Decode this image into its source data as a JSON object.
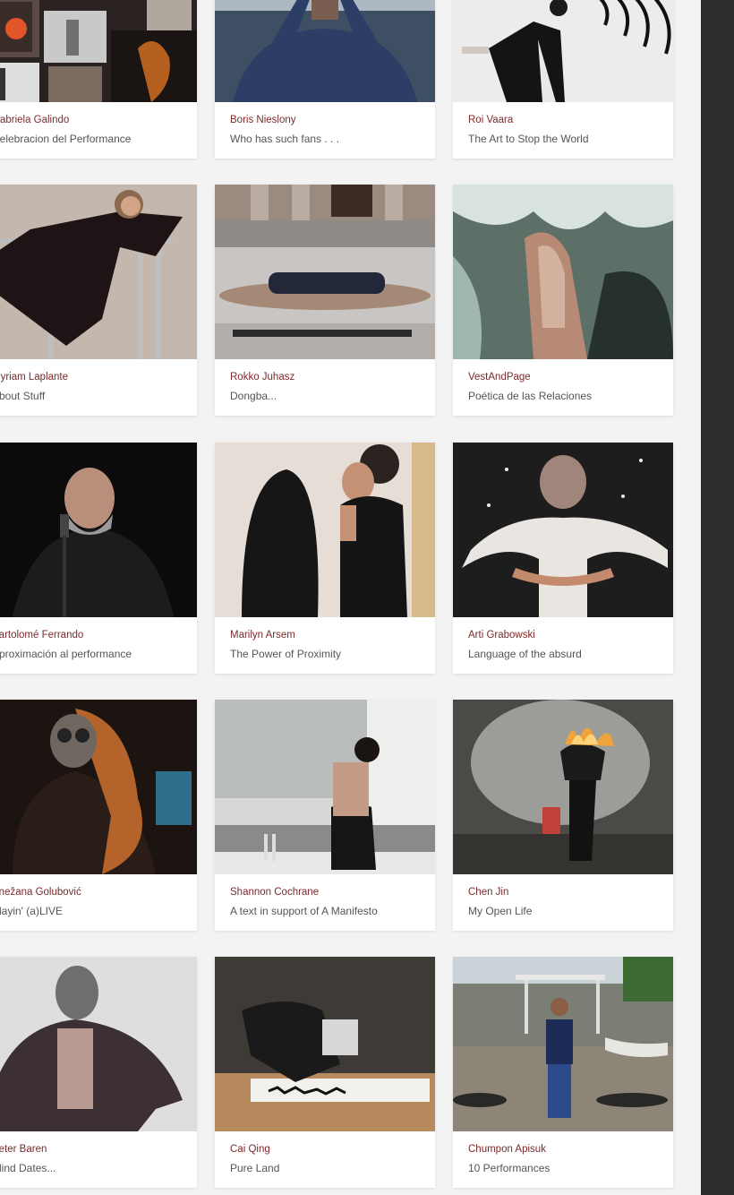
{
  "gallery": {
    "cards": [
      {
        "artist": "Gabriela Galindo",
        "work": "Celebracion del Performance"
      },
      {
        "artist": "Boris Nieslony",
        "work": "Who has such fans . . ."
      },
      {
        "artist": "Roi Vaara",
        "work": "The Art to Stop the World"
      },
      {
        "artist": "Myriam Laplante",
        "work": "About Stuff"
      },
      {
        "artist": "Rokko Juhasz",
        "work": "Dongba..."
      },
      {
        "artist": "VestAndPage",
        "work": "Poética de las Relaciones"
      },
      {
        "artist": "Bartolomé Ferrando",
        "work": "Aproximación al performance"
      },
      {
        "artist": "Marilyn Arsem",
        "work": "The Power of Proximity"
      },
      {
        "artist": "Arti Grabowski",
        "work": "Language of the absurd"
      },
      {
        "artist": "Snežana Golubović",
        "work": "Playin' (a)LIVE"
      },
      {
        "artist": "Shannon Cochrane",
        "work": "A text in support of A Manifesto"
      },
      {
        "artist": "Chen Jin",
        "work": "My Open Life"
      },
      {
        "artist": "Peter Baren",
        "work": "Blind Dates..."
      },
      {
        "artist": "Cai Qing",
        "work": "Pure Land"
      },
      {
        "artist": "Chumpon Apisuk",
        "work": "10 Performances"
      }
    ]
  }
}
